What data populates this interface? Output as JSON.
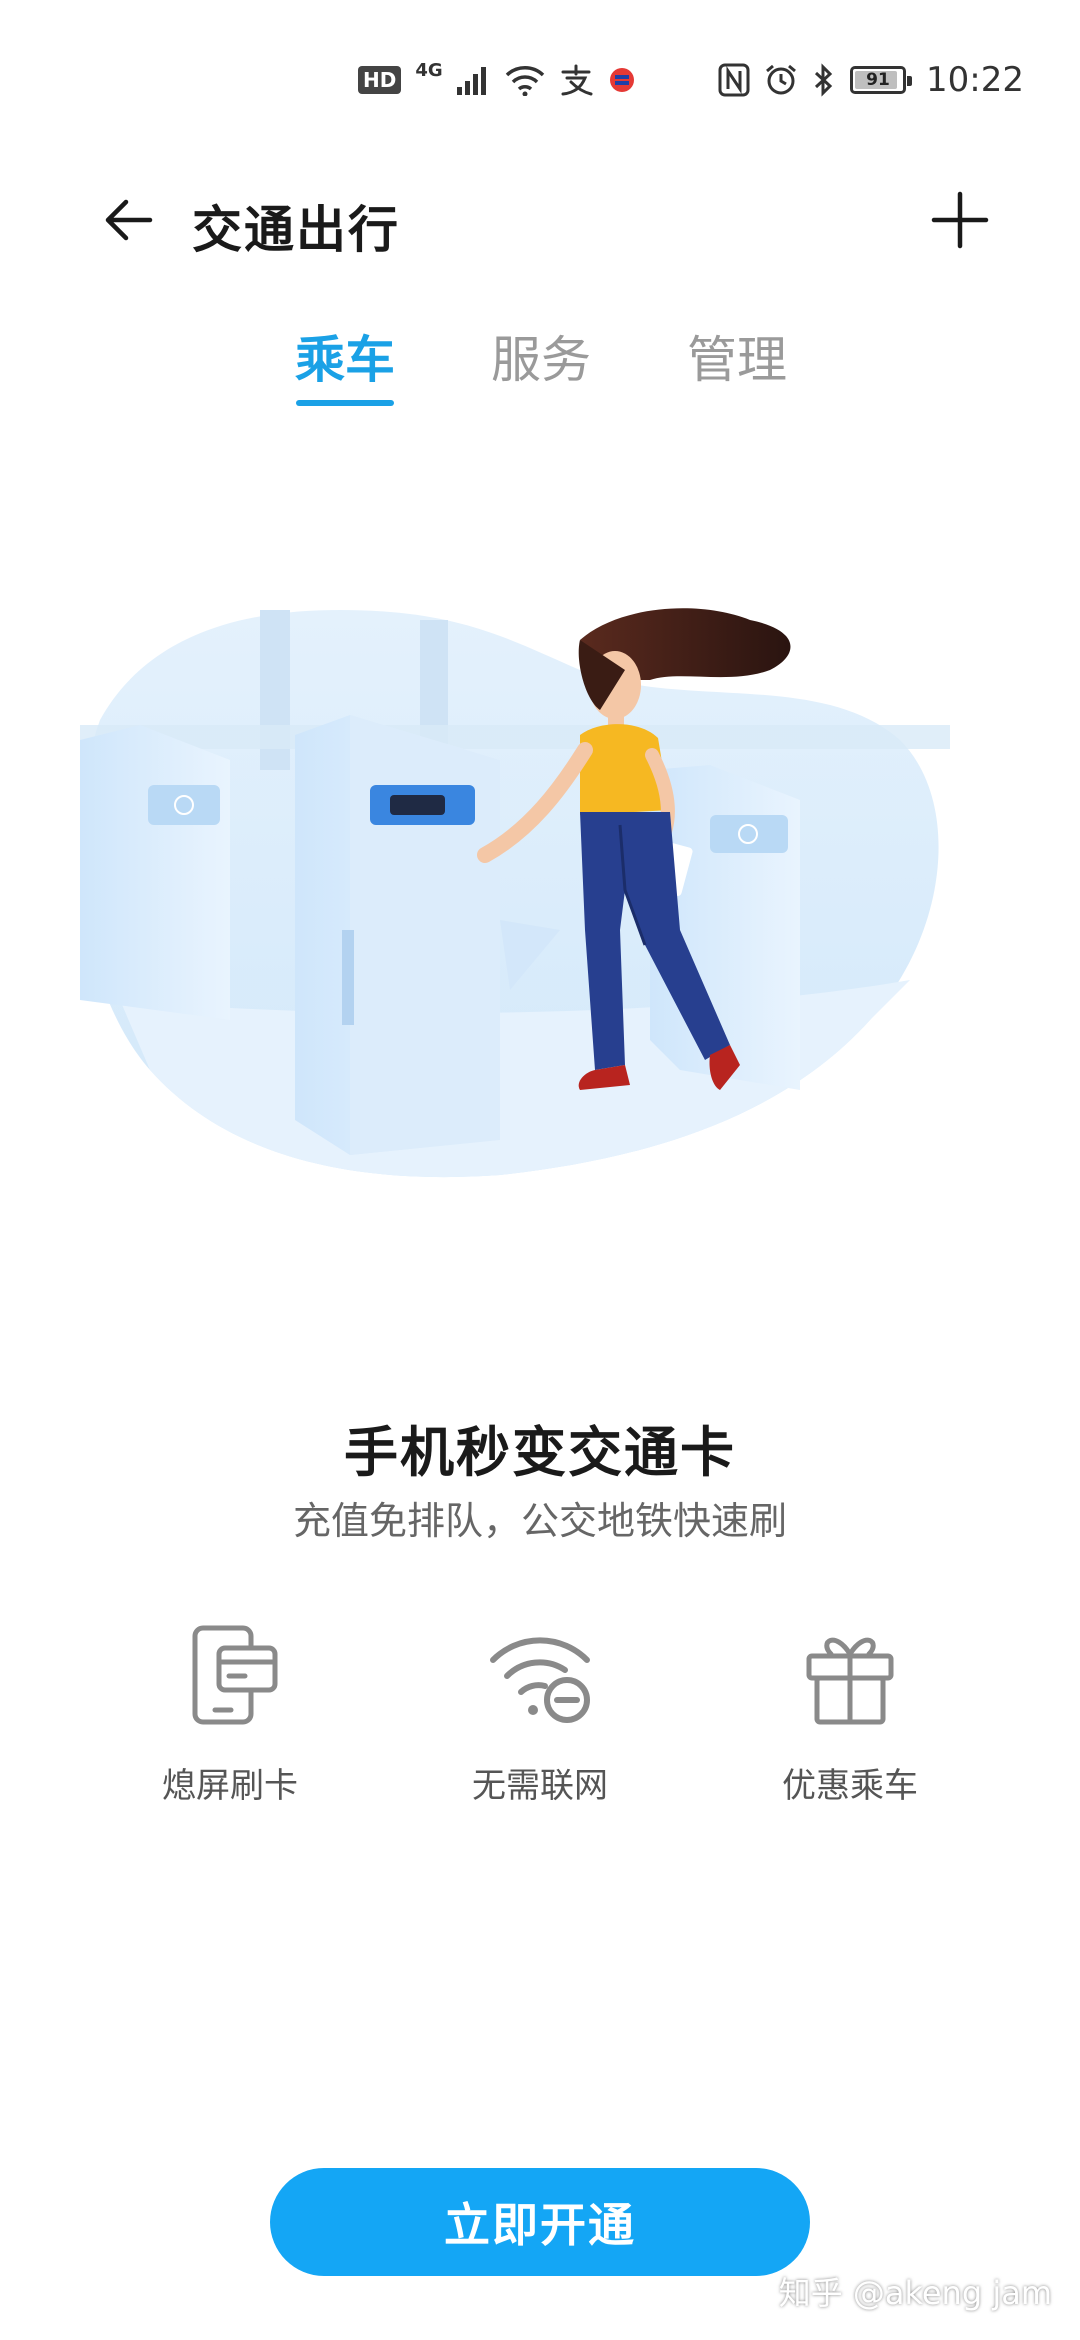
{
  "status_bar": {
    "hd": "HD",
    "network": "4G",
    "battery": "91",
    "battery_level": 0.91,
    "time": "10:22",
    "icons": [
      "signal-icon",
      "wifi-icon",
      "alipay-icon",
      "app-notification-icon",
      "nfc-icon",
      "alarm-icon",
      "bluetooth-icon",
      "battery-icon"
    ]
  },
  "header": {
    "title": "交通出行",
    "back_icon": "arrow-left-icon",
    "add_icon": "plus-icon"
  },
  "tabs": [
    {
      "label": "乘车",
      "active": true
    },
    {
      "label": "服务",
      "active": false
    },
    {
      "label": "管理",
      "active": false
    }
  ],
  "promo": {
    "title": "手机秒变交通卡",
    "subtitle": "充值免排队，公交地铁快速刷"
  },
  "features": [
    {
      "label": "熄屏刷卡",
      "icon": "phone-card-icon"
    },
    {
      "label": "无需联网",
      "icon": "wifi-off-icon"
    },
    {
      "label": "优惠乘车",
      "icon": "gift-icon"
    }
  ],
  "cta": {
    "label": "立即开通"
  },
  "watermark": "知乎 @akeng jam",
  "colors": {
    "accent": "#1aa1e6",
    "button": "#14a6f5",
    "inactive_tab": "#9a9a9a"
  }
}
